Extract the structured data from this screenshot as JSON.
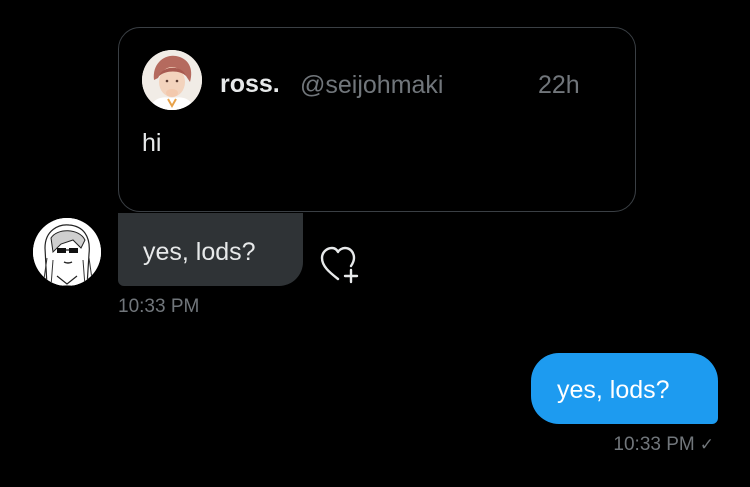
{
  "quoted_tweet": {
    "display_name": "ross.",
    "handle": "@seijohmaki",
    "time": "22h",
    "text": "hi"
  },
  "received_message": {
    "text": "yes, lods?",
    "timestamp": "10:33 PM",
    "reaction_icon": "heart-plus-icon"
  },
  "sent_message": {
    "text": "yes, lods?",
    "timestamp": "10:33 PM",
    "status_icon": "check-icon",
    "status_glyph": "✓"
  },
  "colors": {
    "background": "#000000",
    "sent_bubble": "#1d9bf0",
    "received_bubble": "#2f3336",
    "border": "#3a3f44",
    "primary_text": "#e7e9ea",
    "secondary_text": "#71767b"
  }
}
